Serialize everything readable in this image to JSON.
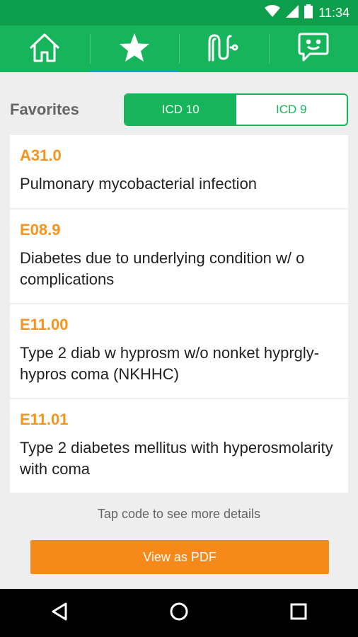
{
  "status_bar": {
    "time": "11:34"
  },
  "tabs": [
    {
      "icon": "home-icon",
      "active": false
    },
    {
      "icon": "star-icon",
      "active": true
    },
    {
      "icon": "stomach-icon",
      "active": false
    },
    {
      "icon": "chat-smile-icon",
      "active": false
    }
  ],
  "favorites": {
    "title": "Favorites",
    "segments": {
      "icd10": "ICD 10",
      "icd9": "ICD 9"
    }
  },
  "items": [
    {
      "code": "A31.0",
      "desc": "Pulmonary mycobacterial infection"
    },
    {
      "code": "E08.9",
      "desc": "Diabetes due to underlying condition w/ o complications"
    },
    {
      "code": "E11.00",
      "desc": "Type 2 diab w hyprosm w/o nonket hyprgly-hypros coma (NKHHC)"
    },
    {
      "code": "E11.01",
      "desc": "Type 2 diabetes mellitus with hyperosmolarity with coma"
    }
  ],
  "footer": {
    "hint": "Tap code to see more details",
    "pdf_button": "View as PDF"
  },
  "colors": {
    "accent_green": "#17b55b",
    "status_green": "#0d9e4c",
    "code_orange": "#f7941d",
    "button_orange": "#f7891a"
  }
}
